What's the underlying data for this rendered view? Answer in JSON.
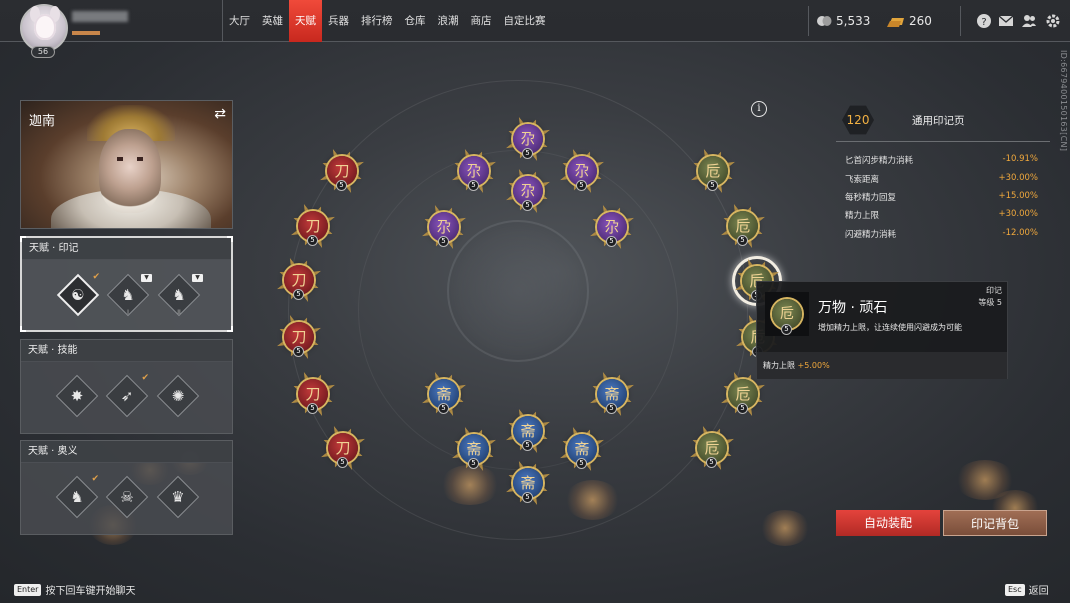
{
  "topbar": {
    "player_level": "56",
    "nav": [
      {
        "label": "大厅",
        "active": false
      },
      {
        "label": "英雄",
        "active": false
      },
      {
        "label": "天赋",
        "active": true
      },
      {
        "label": "兵器",
        "active": false
      },
      {
        "label": "排行榜",
        "active": false
      },
      {
        "label": "仓库",
        "active": false
      },
      {
        "label": "浪潮",
        "active": false
      },
      {
        "label": "商店",
        "active": false
      },
      {
        "label": "自定比赛",
        "active": false
      }
    ],
    "currency_silver": "5,533",
    "currency_gold": "260",
    "icons": [
      "help-icon",
      "mail-icon",
      "friends-icon",
      "settings-icon"
    ]
  },
  "uid": "ID:667940015016​3[CN]",
  "hero": {
    "name": "迦南",
    "swap_icon": "swap-icon"
  },
  "panels": [
    {
      "title": "天赋 · 印记",
      "selected": true
    },
    {
      "title": "天赋 · 技能",
      "selected": false
    },
    {
      "title": "天赋 · 奥义",
      "selected": false
    }
  ],
  "tree": {
    "node_level": "5",
    "colors": {
      "red": "#8a2529",
      "purple": "#5b3486",
      "blue": "#2b4f88",
      "green": "#515b33",
      "gold": "#d6b561"
    }
  },
  "tooltip": {
    "type": "印记",
    "level": "等级 5",
    "name": "万物 · 顽石",
    "desc": "增加精力上限，让连续使用闪避成为可能",
    "stat_label": "精力上限",
    "stat_value": "+5.00%",
    "node_level": "5"
  },
  "right": {
    "points": "120",
    "page_title": "通用印记页",
    "stats": [
      {
        "label": "匕首闪步精力消耗",
        "value": "-10.91%"
      },
      {
        "label": "飞索距离",
        "value": "+30.00%"
      },
      {
        "label": "每秒精力回复",
        "value": "+15.00%"
      },
      {
        "label": "精力上限",
        "value": "+30.00%"
      },
      {
        "label": "闪避精力消耗",
        "value": "-12.00%"
      }
    ],
    "btn_auto": "自动装配",
    "btn_bag": "印记背包"
  },
  "bottom": {
    "enter_key": "Enter",
    "chat_hint": "按下回车键开始聊天",
    "esc_key": "Esc",
    "back_label": "返回"
  }
}
